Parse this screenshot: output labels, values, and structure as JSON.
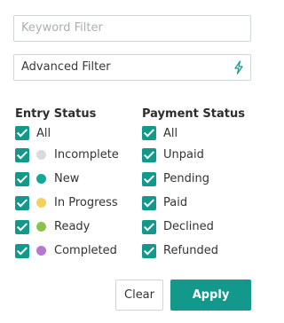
{
  "keyword_filter": {
    "placeholder": "Keyword Filter"
  },
  "advanced_filter": {
    "value": "Advanced Filter",
    "icon": "lightning-bolt-icon"
  },
  "entry_status": {
    "title": "Entry Status",
    "items": [
      {
        "label": "All",
        "checked": true,
        "dot_color": null
      },
      {
        "label": "Incomplete",
        "checked": true,
        "dot_color": "#d9dcdd"
      },
      {
        "label": "New",
        "checked": true,
        "dot_color": "#13a89a"
      },
      {
        "label": "In Progress",
        "checked": true,
        "dot_color": "#f6cf5c"
      },
      {
        "label": "Ready",
        "checked": true,
        "dot_color": "#8bc34a"
      },
      {
        "label": "Completed",
        "checked": true,
        "dot_color": "#b977d4"
      }
    ]
  },
  "payment_status": {
    "title": "Payment Status",
    "items": [
      {
        "label": "All",
        "checked": true
      },
      {
        "label": "Unpaid",
        "checked": true
      },
      {
        "label": "Pending",
        "checked": true
      },
      {
        "label": "Paid",
        "checked": true
      },
      {
        "label": "Declined",
        "checked": true
      },
      {
        "label": "Refunded",
        "checked": true
      }
    ]
  },
  "buttons": {
    "clear": "Clear",
    "apply": "Apply"
  },
  "colors": {
    "accent": "#13998c",
    "border": "#cfd6da"
  }
}
